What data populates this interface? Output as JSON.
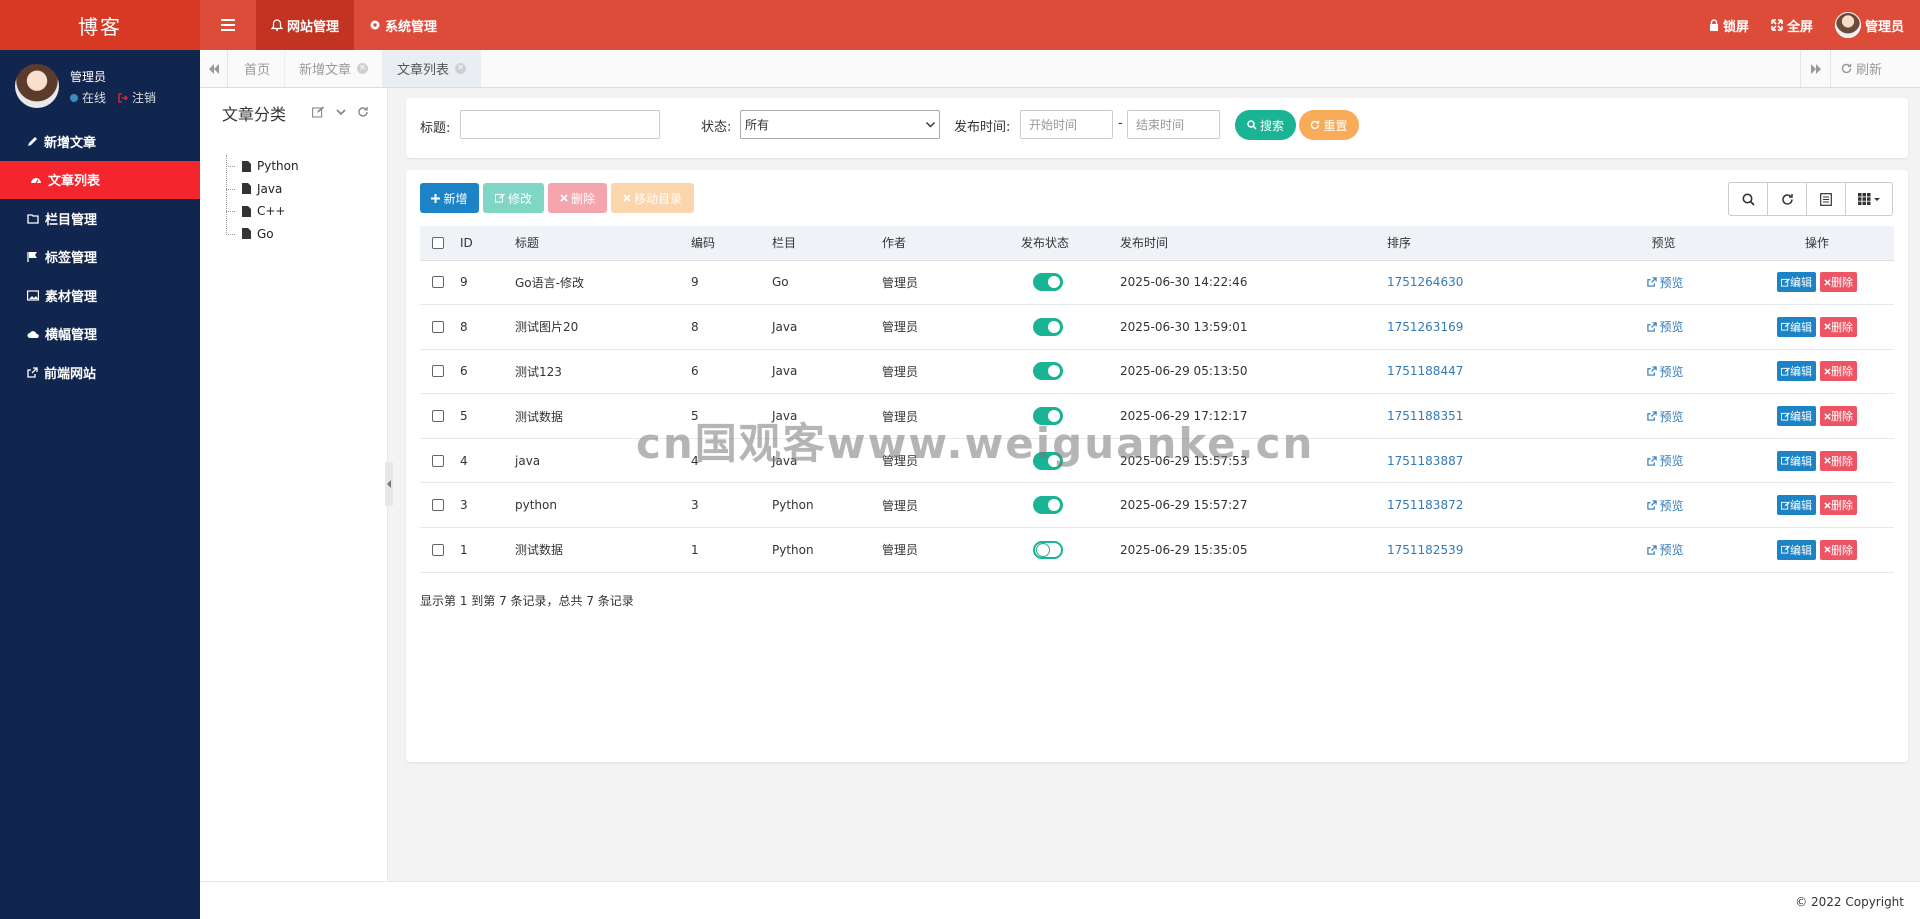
{
  "app": {
    "logo": "博客"
  },
  "topnav": [
    {
      "label": "网站管理",
      "icon": "bell-icon"
    },
    {
      "label": "系统管理",
      "icon": "gear-icon"
    }
  ],
  "topright": {
    "lock": "锁屏",
    "fullscreen": "全屏",
    "user": "管理员"
  },
  "sidebar": {
    "user_name": "管理员",
    "status_online": "在线",
    "logout": "注销",
    "items": [
      {
        "label": "新增文章",
        "icon": "pencil-icon"
      },
      {
        "label": "文章列表",
        "icon": "dashboard-icon"
      },
      {
        "label": "栏目管理",
        "icon": "folder-icon"
      },
      {
        "label": "标签管理",
        "icon": "flag-icon"
      },
      {
        "label": "素材管理",
        "icon": "image-icon"
      },
      {
        "label": "横幅管理",
        "icon": "cloud-icon"
      },
      {
        "label": "前端网站",
        "icon": "external-link-icon"
      }
    ]
  },
  "tabs": [
    {
      "label": "首页"
    },
    {
      "label": "新增文章"
    },
    {
      "label": "文章列表"
    }
  ],
  "refresh_label": "刷新",
  "category": {
    "title": "文章分类",
    "items": [
      "Python",
      "Java",
      "C++",
      "Go"
    ]
  },
  "search": {
    "title_label": "标题:",
    "title_value": "",
    "status_label": "状态:",
    "status_value": "所有",
    "time_label": "发布时间:",
    "start_placeholder": "开始时间",
    "end_placeholder": "结束时间",
    "dash": "-",
    "search_btn": "搜索",
    "reset_btn": "重置"
  },
  "toolbar": {
    "add": "新增",
    "edit": "修改",
    "delete": "删除",
    "move": "移动目录"
  },
  "table": {
    "headers": [
      "ID",
      "标题",
      "编码",
      "栏目",
      "作者",
      "发布状态",
      "发布时间",
      "排序",
      "预览",
      "操作"
    ],
    "rows": [
      {
        "id": "9",
        "title": "Go语言-修改",
        "code": "9",
        "column": "Go",
        "author": "管理员",
        "published": true,
        "time": "2025-06-30 14:22:46",
        "sort": "1751264630"
      },
      {
        "id": "8",
        "title": "测试图片20",
        "code": "8",
        "column": "Java",
        "author": "管理员",
        "published": true,
        "time": "2025-06-30 13:59:01",
        "sort": "1751263169"
      },
      {
        "id": "6",
        "title": "测试123",
        "code": "6",
        "column": "Java",
        "author": "管理员",
        "published": true,
        "time": "2025-06-29 05:13:50",
        "sort": "1751188447"
      },
      {
        "id": "5",
        "title": "测试数据",
        "code": "5",
        "column": "Java",
        "author": "管理员",
        "published": true,
        "time": "2025-06-29 17:12:17",
        "sort": "1751188351"
      },
      {
        "id": "4",
        "title": "java",
        "code": "4",
        "column": "Java",
        "author": "管理员",
        "published": true,
        "time": "2025-06-29 15:57:53",
        "sort": "1751183887"
      },
      {
        "id": "3",
        "title": "python",
        "code": "3",
        "column": "Python",
        "author": "管理员",
        "published": true,
        "time": "2025-06-29 15:57:27",
        "sort": "1751183872"
      },
      {
        "id": "1",
        "title": "测试数据",
        "code": "1",
        "column": "Python",
        "author": "管理员",
        "published": false,
        "time": "2025-06-29 15:35:05",
        "sort": "1751182539"
      }
    ],
    "preview_label": "预览",
    "edit_label": "编辑",
    "delete_label": "删除"
  },
  "pageinfo": "显示第 1 到第 7 条记录，总共 7 条记录",
  "footer": "© 2022 Copyright",
  "watermark": "cn国观客www.weiguanke.cn",
  "colors": {
    "header": "#dd4b39",
    "sidebar": "#11264f",
    "active_menu": "#f4252c",
    "primary": "#1c84c6",
    "success": "#1ab394",
    "danger": "#ed5565",
    "warning": "#f8ac59"
  }
}
